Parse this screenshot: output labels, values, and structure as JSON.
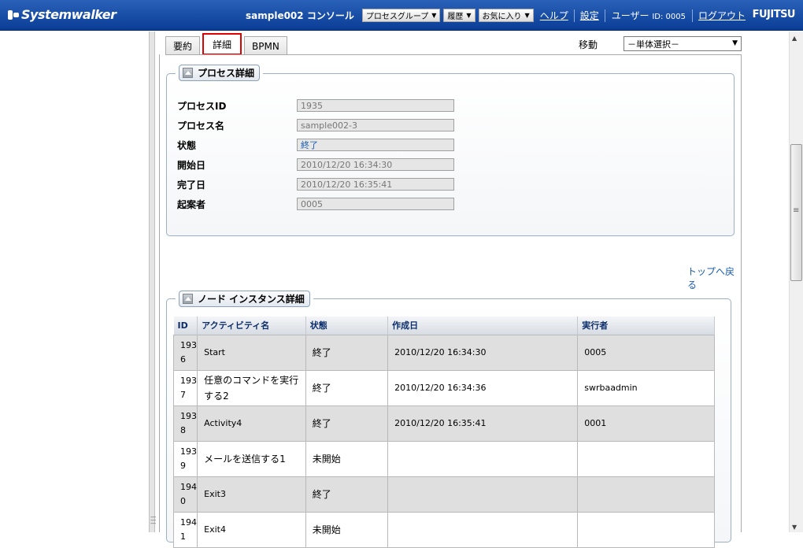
{
  "header": {
    "logo": "Systemwalker",
    "console_title": "sample002 コンソール",
    "menus": [
      {
        "label": "プロセスグループ"
      },
      {
        "label": "履歴"
      },
      {
        "label": "お気に入り"
      }
    ],
    "help": "ヘルプ",
    "settings": "設定",
    "user_label": "ユーザー",
    "user_id": "ID: 0005",
    "logout": "ログアウト",
    "brand": "FUJITSU"
  },
  "tabs": [
    {
      "label": "要約"
    },
    {
      "label": "詳細"
    },
    {
      "label": "BPMN"
    }
  ],
  "move": {
    "label": "移動",
    "selected": "－単体選択－"
  },
  "process_detail": {
    "title": "プロセス詳細",
    "rows": [
      {
        "label": "プロセスID",
        "value": "1935"
      },
      {
        "label": "プロセス名",
        "value": "sample002-3"
      },
      {
        "label": "状態",
        "value": "終了"
      },
      {
        "label": "開始日",
        "value": "2010/12/20 16:34:30"
      },
      {
        "label": "完了日",
        "value": "2010/12/20 16:35:41"
      },
      {
        "label": "起案者",
        "value": "0005"
      }
    ]
  },
  "top_link": "トップへ戻る",
  "node_detail": {
    "title": "ノード インスタンス詳細",
    "columns": [
      "ID",
      "アクティビティ名",
      "状態",
      "作成日",
      "実行者"
    ],
    "rows": [
      {
        "id_a": "193",
        "id_b": "6",
        "activity": "Start",
        "state": "終了",
        "created": "2010/12/20 16:34:30",
        "executor": "0005"
      },
      {
        "id_a": "193",
        "id_b": "7",
        "activity": "任意のコマンドを実行する2",
        "state": "終了",
        "created": "2010/12/20 16:34:36",
        "executor": "swrbaadmin"
      },
      {
        "id_a": "193",
        "id_b": "8",
        "activity": "Activity4",
        "state": "終了",
        "created": "2010/12/20 16:35:41",
        "executor": "0001"
      },
      {
        "id_a": "193",
        "id_b": "9",
        "activity": "メールを送信する1",
        "state": "未開始",
        "created": "",
        "executor": ""
      },
      {
        "id_a": "194",
        "id_b": "0",
        "activity": "Exit3",
        "state": "終了",
        "created": "",
        "executor": ""
      },
      {
        "id_a": "194",
        "id_b": "1",
        "activity": "Exit4",
        "state": "未開始",
        "created": "",
        "executor": ""
      }
    ]
  }
}
